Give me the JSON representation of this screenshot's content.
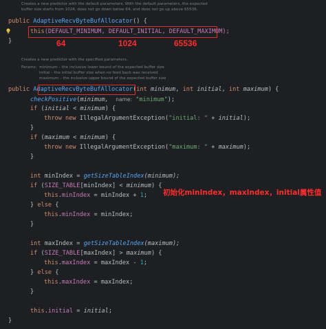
{
  "doc1": {
    "line1": "Creates a new predictor with the default parameters. With the default parameters, the expected",
    "line2": "buffer size starts from 1024, does not go down below 64, and does not go up above 65536."
  },
  "code1": {
    "l1_kw": "public",
    "l1_name": "AdaptiveRecvByteBufAllocator",
    "l1_rest": "() {",
    "l2_this": "this",
    "l2_args": "(DEFAULT_MINIMUM, DEFAULT_INITIAL, DEFAULT_MAXIMUM);",
    "l3": "}"
  },
  "annotations_top": {
    "min": "64",
    "initial": "1024",
    "max": "65536"
  },
  "doc2": {
    "line1": "Creates a new predictor with the specified parameters.",
    "line2_label": "Params:",
    "line2": "minimum – the inclusive lower bound of the expected buffer size",
    "line3": "initial – the initial buffer size when no feed back was received",
    "line4": "maximum – the inclusive upper bound of the expected buffer size"
  },
  "code2": {
    "sig_kw": "public",
    "sig_name": "AdaptiveRecvByteBufAllocator",
    "sig_params": "(int minimum, int initial, int maximum) {",
    "check_fn": "checkPositive",
    "check_arg": "minimum,",
    "check_hint": "name:",
    "check_str": "\"minimum\"",
    "check_end": ");",
    "if1": "if (initial < minimum) {",
    "throw1_kw": "throw new",
    "throw1_cls": "IllegalArgumentException(",
    "throw1_str": "\"initial: \"",
    "throw1_rest": " + initial);",
    "close1": "}",
    "if2": "if (maximum < minimum) {",
    "throw2_str": "\"maximum: \"",
    "throw2_rest": " + maximum);",
    "close2": "}",
    "minidx_decl": "int minIndex = ",
    "minidx_fn": "getSizeTableIndex",
    "minidx_arg": "(minimum);",
    "if3": "if (SIZE_TABLE[minIndex] < minimum) {",
    "assign_min1": "this.minIndex = minIndex + 1;",
    "else1": "} else {",
    "assign_min2": "this.minIndex = minIndex;",
    "close3": "}",
    "maxidx_decl": "int maxIndex = ",
    "maxidx_fn": "getSizeTableIndex",
    "maxidx_arg": "(maximum);",
    "if4": "if (SIZE_TABLE[maxIndex] > maximum) {",
    "assign_max1": "this.maxIndex = maxIndex - 1;",
    "else2": "} else {",
    "assign_max2": "this.maxIndex = maxIndex;",
    "close4": "}",
    "init_assign": "this.initial = initial;",
    "close_sig": "}"
  },
  "annotation_cn": "初始化minIndex，maxIndex，initial属性值",
  "colors": {
    "background": "#1e1f22",
    "keyword": "#cf8e6d",
    "method": "#56a8f5",
    "field": "#c77dbb",
    "string": "#6aab73",
    "number": "#2aacb8",
    "annotation_red": "#e0312c"
  },
  "icons": {
    "gutter_hint": "lightbulb-icon"
  }
}
